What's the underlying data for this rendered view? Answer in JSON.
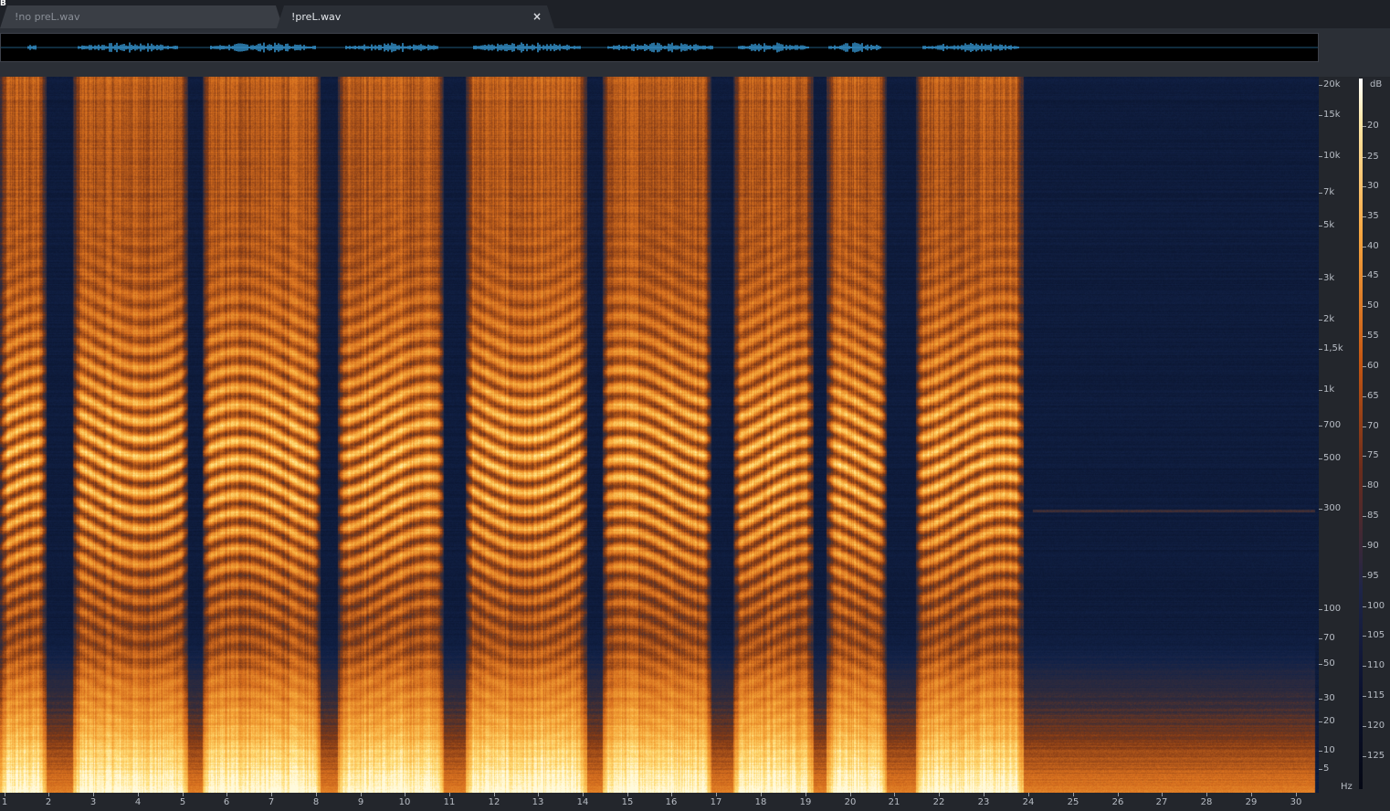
{
  "tabs": [
    {
      "label": "!no preL.wav",
      "active": false
    },
    {
      "label": "!preL.wav",
      "active": true,
      "close_glyph": "×"
    }
  ],
  "corner_mark": "B",
  "freq_axis": {
    "unit": "Hz",
    "labels": [
      "20k",
      "15k",
      "10k",
      "7k",
      "5k",
      "3k",
      "2k",
      "1,5k",
      "1k",
      "700",
      "500",
      "300",
      "100",
      "70",
      "50",
      "30",
      "20",
      "10",
      "5"
    ]
  },
  "db_scale": {
    "unit": "dB",
    "labels": [
      "20",
      "25",
      "30",
      "35",
      "40",
      "45",
      "50",
      "55",
      "60",
      "65",
      "70",
      "75",
      "80",
      "85",
      "90",
      "95",
      "100",
      "105",
      "110",
      "115",
      "120",
      "125"
    ]
  },
  "time_axis": {
    "labels": [
      "1",
      "2",
      "3",
      "4",
      "5",
      "6",
      "7",
      "8",
      "9",
      "10",
      "11",
      "12",
      "13",
      "14",
      "15",
      "16",
      "17",
      "18",
      "19",
      "20",
      "21",
      "22",
      "23",
      "24",
      "25",
      "26",
      "27",
      "28",
      "29",
      "30"
    ]
  },
  "colors": {
    "background": "#2b2f36",
    "tabbar": "#1e2127",
    "waveform": "#3aa0e0",
    "spectro_low": "#0a1630",
    "spectro_high": "#ffe9a0"
  }
}
